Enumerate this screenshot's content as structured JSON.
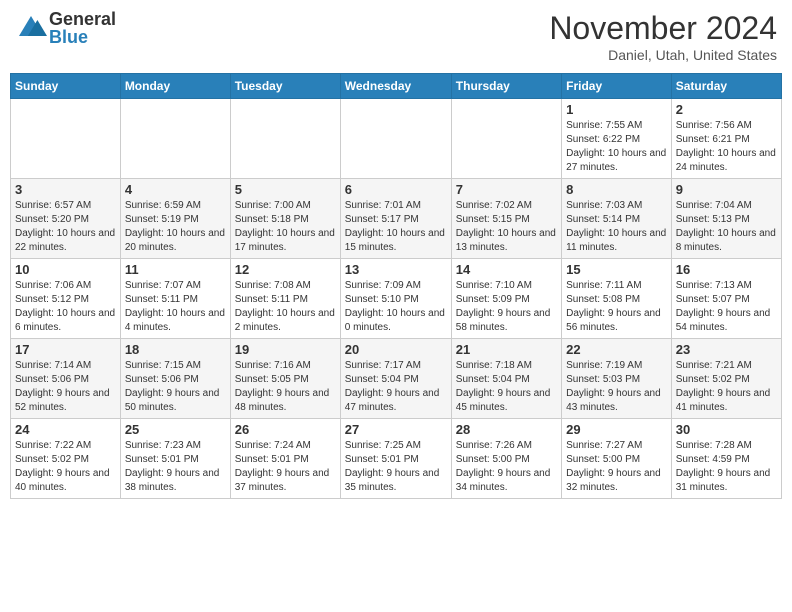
{
  "header": {
    "logo_general": "General",
    "logo_blue": "Blue",
    "month": "November 2024",
    "location": "Daniel, Utah, United States"
  },
  "weekdays": [
    "Sunday",
    "Monday",
    "Tuesday",
    "Wednesday",
    "Thursday",
    "Friday",
    "Saturday"
  ],
  "rows": [
    [
      {
        "day": "",
        "info": ""
      },
      {
        "day": "",
        "info": ""
      },
      {
        "day": "",
        "info": ""
      },
      {
        "day": "",
        "info": ""
      },
      {
        "day": "",
        "info": ""
      },
      {
        "day": "1",
        "info": "Sunrise: 7:55 AM\nSunset: 6:22 PM\nDaylight: 10 hours and 27 minutes."
      },
      {
        "day": "2",
        "info": "Sunrise: 7:56 AM\nSunset: 6:21 PM\nDaylight: 10 hours and 24 minutes."
      }
    ],
    [
      {
        "day": "3",
        "info": "Sunrise: 6:57 AM\nSunset: 5:20 PM\nDaylight: 10 hours and 22 minutes."
      },
      {
        "day": "4",
        "info": "Sunrise: 6:59 AM\nSunset: 5:19 PM\nDaylight: 10 hours and 20 minutes."
      },
      {
        "day": "5",
        "info": "Sunrise: 7:00 AM\nSunset: 5:18 PM\nDaylight: 10 hours and 17 minutes."
      },
      {
        "day": "6",
        "info": "Sunrise: 7:01 AM\nSunset: 5:17 PM\nDaylight: 10 hours and 15 minutes."
      },
      {
        "day": "7",
        "info": "Sunrise: 7:02 AM\nSunset: 5:15 PM\nDaylight: 10 hours and 13 minutes."
      },
      {
        "day": "8",
        "info": "Sunrise: 7:03 AM\nSunset: 5:14 PM\nDaylight: 10 hours and 11 minutes."
      },
      {
        "day": "9",
        "info": "Sunrise: 7:04 AM\nSunset: 5:13 PM\nDaylight: 10 hours and 8 minutes."
      }
    ],
    [
      {
        "day": "10",
        "info": "Sunrise: 7:06 AM\nSunset: 5:12 PM\nDaylight: 10 hours and 6 minutes."
      },
      {
        "day": "11",
        "info": "Sunrise: 7:07 AM\nSunset: 5:11 PM\nDaylight: 10 hours and 4 minutes."
      },
      {
        "day": "12",
        "info": "Sunrise: 7:08 AM\nSunset: 5:11 PM\nDaylight: 10 hours and 2 minutes."
      },
      {
        "day": "13",
        "info": "Sunrise: 7:09 AM\nSunset: 5:10 PM\nDaylight: 10 hours and 0 minutes."
      },
      {
        "day": "14",
        "info": "Sunrise: 7:10 AM\nSunset: 5:09 PM\nDaylight: 9 hours and 58 minutes."
      },
      {
        "day": "15",
        "info": "Sunrise: 7:11 AM\nSunset: 5:08 PM\nDaylight: 9 hours and 56 minutes."
      },
      {
        "day": "16",
        "info": "Sunrise: 7:13 AM\nSunset: 5:07 PM\nDaylight: 9 hours and 54 minutes."
      }
    ],
    [
      {
        "day": "17",
        "info": "Sunrise: 7:14 AM\nSunset: 5:06 PM\nDaylight: 9 hours and 52 minutes."
      },
      {
        "day": "18",
        "info": "Sunrise: 7:15 AM\nSunset: 5:06 PM\nDaylight: 9 hours and 50 minutes."
      },
      {
        "day": "19",
        "info": "Sunrise: 7:16 AM\nSunset: 5:05 PM\nDaylight: 9 hours and 48 minutes."
      },
      {
        "day": "20",
        "info": "Sunrise: 7:17 AM\nSunset: 5:04 PM\nDaylight: 9 hours and 47 minutes."
      },
      {
        "day": "21",
        "info": "Sunrise: 7:18 AM\nSunset: 5:04 PM\nDaylight: 9 hours and 45 minutes."
      },
      {
        "day": "22",
        "info": "Sunrise: 7:19 AM\nSunset: 5:03 PM\nDaylight: 9 hours and 43 minutes."
      },
      {
        "day": "23",
        "info": "Sunrise: 7:21 AM\nSunset: 5:02 PM\nDaylight: 9 hours and 41 minutes."
      }
    ],
    [
      {
        "day": "24",
        "info": "Sunrise: 7:22 AM\nSunset: 5:02 PM\nDaylight: 9 hours and 40 minutes."
      },
      {
        "day": "25",
        "info": "Sunrise: 7:23 AM\nSunset: 5:01 PM\nDaylight: 9 hours and 38 minutes."
      },
      {
        "day": "26",
        "info": "Sunrise: 7:24 AM\nSunset: 5:01 PM\nDaylight: 9 hours and 37 minutes."
      },
      {
        "day": "27",
        "info": "Sunrise: 7:25 AM\nSunset: 5:01 PM\nDaylight: 9 hours and 35 minutes."
      },
      {
        "day": "28",
        "info": "Sunrise: 7:26 AM\nSunset: 5:00 PM\nDaylight: 9 hours and 34 minutes."
      },
      {
        "day": "29",
        "info": "Sunrise: 7:27 AM\nSunset: 5:00 PM\nDaylight: 9 hours and 32 minutes."
      },
      {
        "day": "30",
        "info": "Sunrise: 7:28 AM\nSunset: 4:59 PM\nDaylight: 9 hours and 31 minutes."
      }
    ]
  ]
}
